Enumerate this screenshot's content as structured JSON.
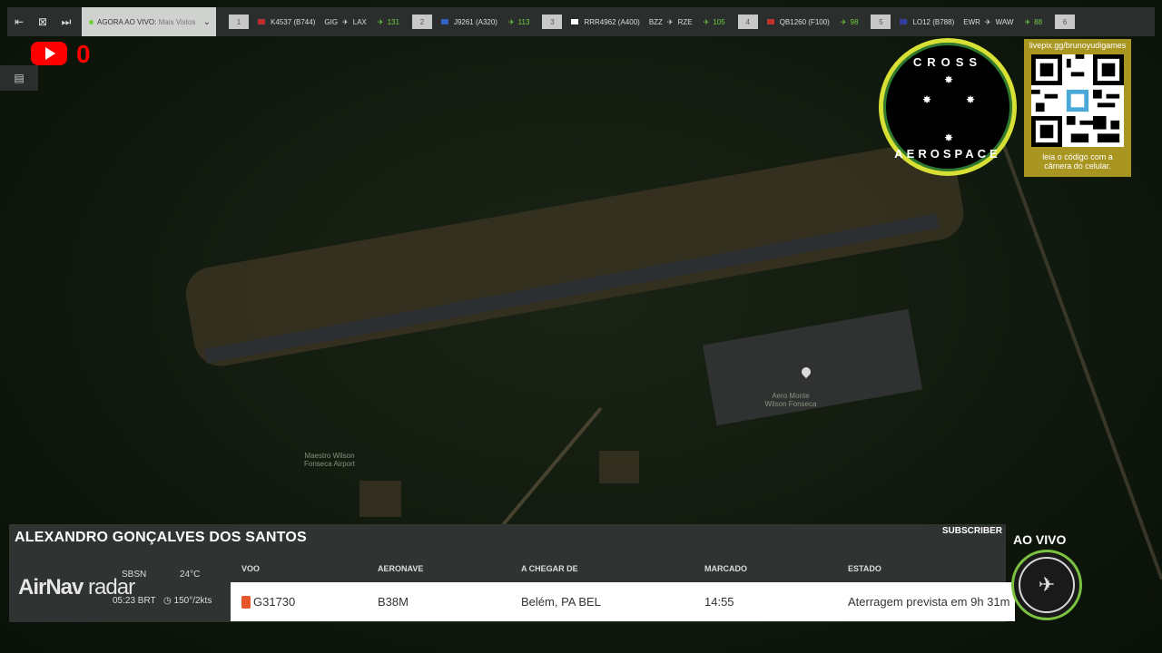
{
  "topbar": {
    "live_label": "AGORA AO VIVO:",
    "live_sub": "Mais Vistos",
    "flights": [
      {
        "num": "1",
        "flight": "K4537 (B744)",
        "from": "GIG",
        "to": "LAX",
        "count": "131",
        "flag_color": "#c03030"
      },
      {
        "num": "2",
        "flight": "J9261 (A320)",
        "from": "",
        "to": "",
        "count": "113",
        "flag_color": "#3060c0"
      },
      {
        "num": "3",
        "flight": "RRR4962 (A400)",
        "from": "BZZ",
        "to": "RZE",
        "count": "105",
        "flag_color": "#ffffff"
      },
      {
        "num": "4",
        "flight": "QB1260 (F100)",
        "from": "",
        "to": "",
        "count": "98",
        "flag_color": "#c03030"
      },
      {
        "num": "5",
        "flight": "LO12 (B788)",
        "from": "EWR",
        "to": "WAW",
        "count": "88",
        "flag_color": "#3040a0"
      },
      {
        "num": "6",
        "flight": "",
        "from": "",
        "to": "",
        "count": "",
        "flag_color": "#888888"
      }
    ]
  },
  "youtube": {
    "count": "0"
  },
  "logo": {
    "top_text": "CROSS",
    "bottom_text": "AEROSPACE"
  },
  "qr": {
    "url": "livepix.gg/brunoyudigames",
    "caption_line1": "leia o código com a",
    "caption_line2": "câmera do celular."
  },
  "map": {
    "airport_label_line1": "Maestro Wilson",
    "airport_label_line2": "Fonseca Airport",
    "pin_label_line1": "Aero Monte",
    "pin_label_line2": "Wilson Fonseca"
  },
  "panel": {
    "name": "ALEXANDRO GONÇALVES DOS SANTOS",
    "subscriber": "SUBSCRIBER",
    "logo_air": "AirNav",
    "logo_radar": "radar",
    "airport_code": "SBSN",
    "time": "05:23 BRT",
    "temp": "24°C",
    "wind": "150°/2kts",
    "columns": {
      "voo": "VOO",
      "aeronave": "AERONAVE",
      "chegar": "A CHEGAR DE",
      "marcado": "MARCADO",
      "estado": "ESTADO"
    },
    "row": {
      "voo": "G31730",
      "aeronave": "B38M",
      "chegar": "Belém, PA BEL",
      "marcado": "14:55",
      "estado": "Aterragem prevista em 9h 31m"
    }
  },
  "live_badge": {
    "label": "AO VIVO"
  }
}
